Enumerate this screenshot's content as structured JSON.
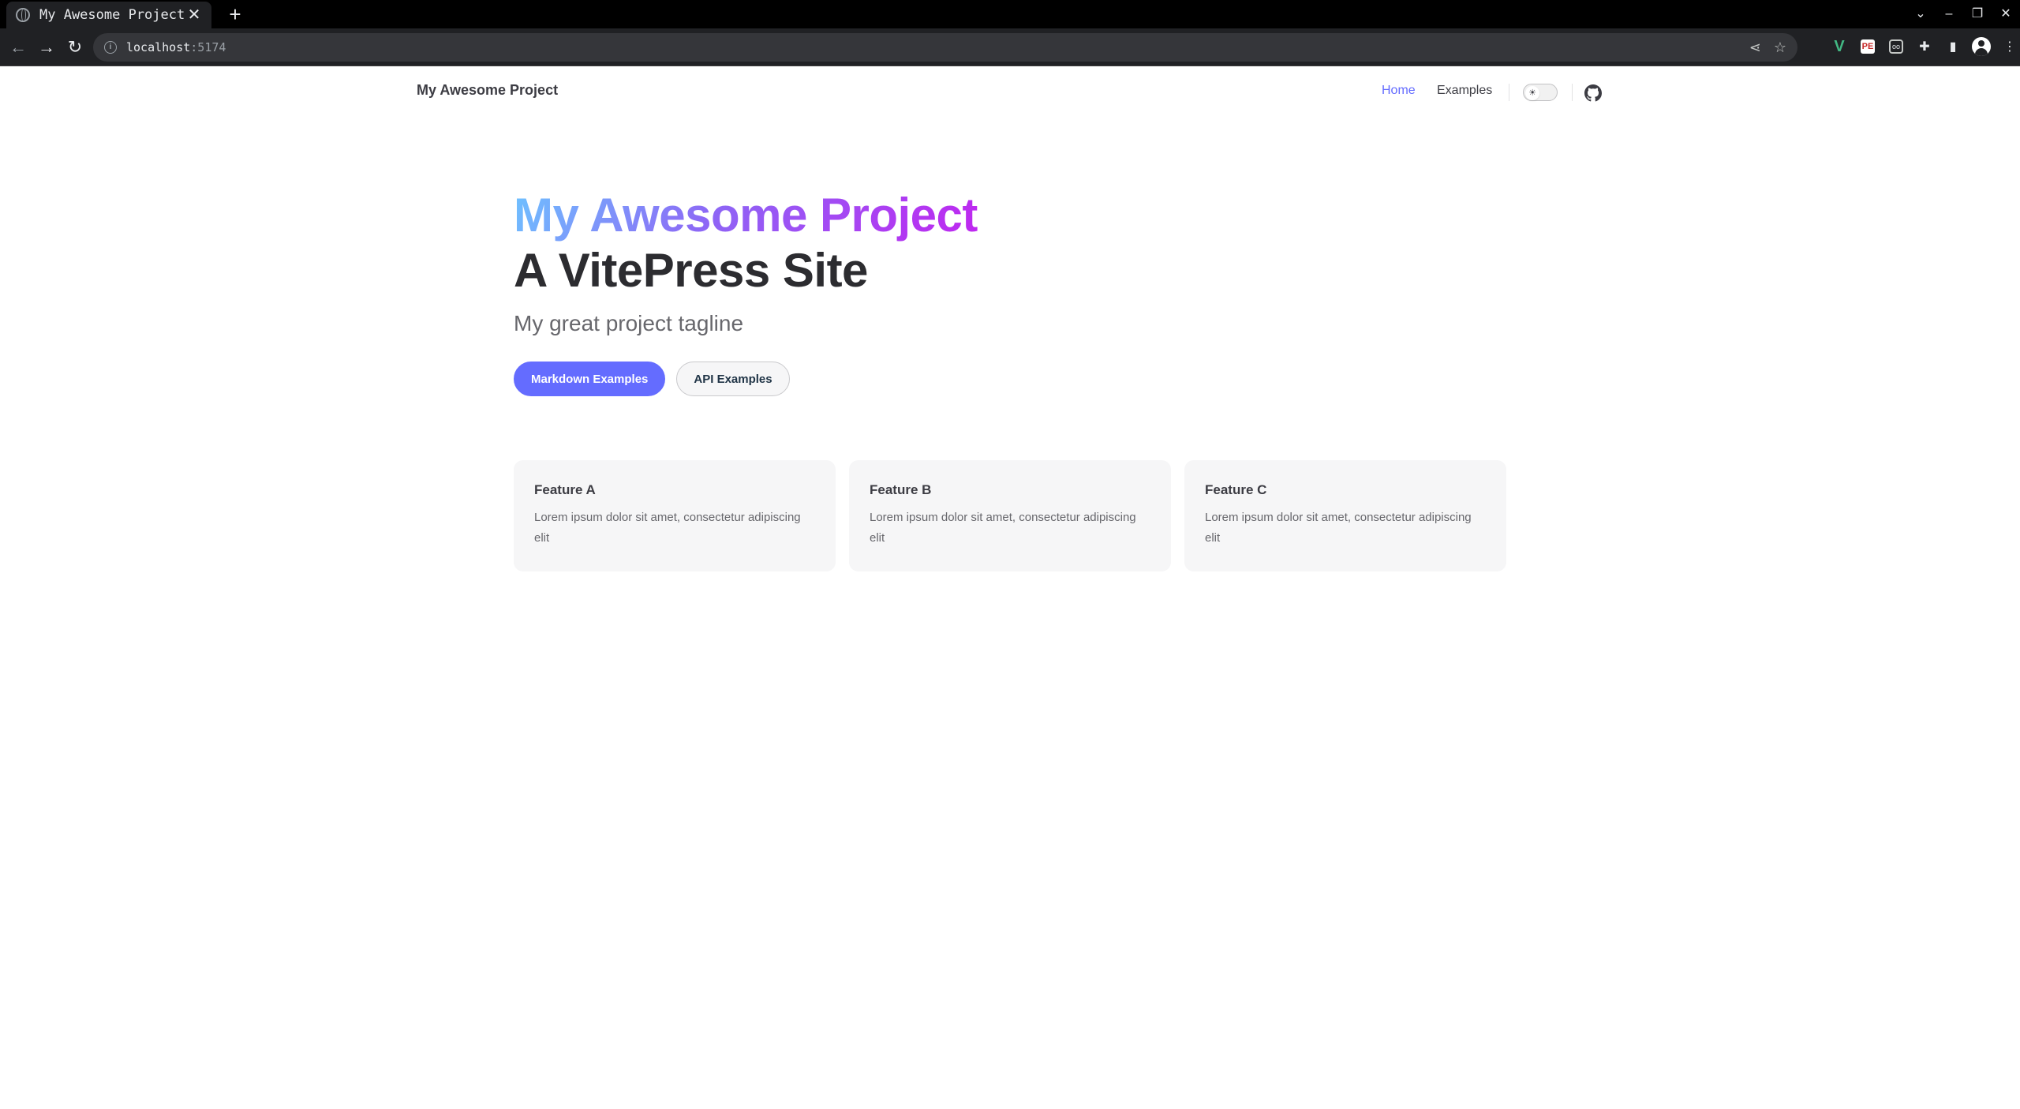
{
  "browser": {
    "tab_title": "My Awesome Project",
    "tab_close": "✕",
    "new_tab": "+",
    "url_host": "localhost",
    "url_port": ":5174",
    "window_controls": [
      "⌄",
      "–",
      "❐",
      "✕"
    ],
    "extensions": [
      "V",
      "PE",
      "oo",
      "✦"
    ]
  },
  "nav": {
    "site_title": "My Awesome Project",
    "links": [
      {
        "label": "Home",
        "active": true
      },
      {
        "label": "Examples",
        "active": false
      }
    ],
    "appearance_icon": "☀"
  },
  "hero": {
    "name": "My Awesome Project",
    "text": "A VitePress Site",
    "tagline": "My great project tagline",
    "actions": [
      {
        "label": "Markdown Examples",
        "theme": "brand"
      },
      {
        "label": "API Examples",
        "theme": "alt"
      }
    ]
  },
  "features": [
    {
      "title": "Feature A",
      "details": "Lorem ipsum dolor sit amet, consectetur adipiscing elit"
    },
    {
      "title": "Feature B",
      "details": "Lorem ipsum dolor sit amet, consectetur adipiscing elit"
    },
    {
      "title": "Feature C",
      "details": "Lorem ipsum dolor sit amet, consectetur adipiscing elit"
    }
  ],
  "colors": {
    "brand": "#646cff",
    "text": "#3c3c43",
    "feature_bg": "#f6f6f7"
  }
}
